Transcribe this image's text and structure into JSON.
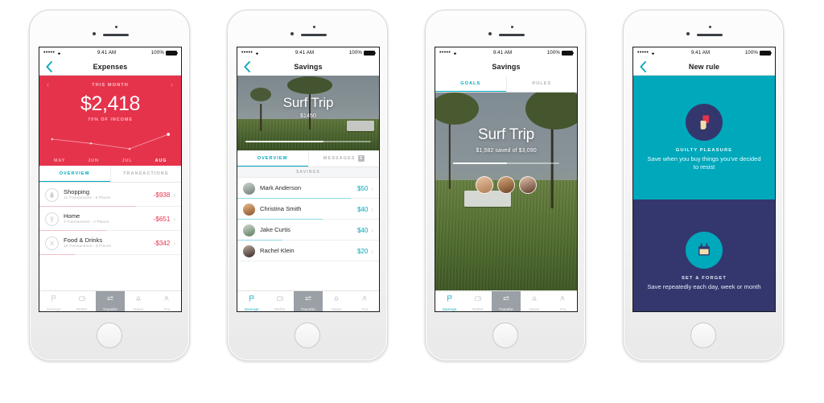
{
  "colors": {
    "red": "#e6334c",
    "teal": "#00a8bc",
    "navy": "#33376e",
    "gray": "#9aa0a6"
  },
  "statusbar": {
    "signal": "•••••",
    "time": "9:41 AM",
    "battery": "100%"
  },
  "tabbar": {
    "items": [
      {
        "label": "Savings",
        "icon": "flag-icon"
      },
      {
        "label": "Wallet",
        "icon": "wallet-icon"
      },
      {
        "label": "Transfer",
        "icon": "transfer-icon"
      },
      {
        "label": "News",
        "icon": "bell-icon"
      },
      {
        "label": "You",
        "icon": "person-icon"
      }
    ]
  },
  "phone1": {
    "nav_title": "Expenses",
    "hero": {
      "period_label": "THIS MONTH",
      "amount": "$2,418",
      "subtitle": "70% OF INCOME"
    },
    "chart_data": {
      "type": "line",
      "title": "Monthly expenses",
      "categories": [
        "MAY",
        "JUN",
        "JUL",
        "AUG"
      ],
      "values": [
        72,
        58,
        40,
        88
      ],
      "highlight_index": 3,
      "xlabel": "",
      "ylabel": "",
      "ylim": [
        0,
        100
      ],
      "grid": false,
      "legend": "none"
    },
    "tabs": [
      {
        "label": "OVERVIEW",
        "active": true
      },
      {
        "label": "TRANSACTIONS",
        "active": false
      }
    ],
    "rows": [
      {
        "title": "Shopping",
        "sub": "11 Transactions - 9 Places",
        "value": "-$938",
        "icon": "shopping-bag-icon",
        "bar": 68
      },
      {
        "title": "Home",
        "sub": "3 Transactions - 2 Places",
        "value": "-$651",
        "icon": "lamp-icon",
        "bar": 47
      },
      {
        "title": "Food & Drinks",
        "sub": "16 Transactions - 8 Places",
        "value": "-$342",
        "icon": "cutlery-icon",
        "bar": 25
      }
    ]
  },
  "phone2": {
    "nav_title": "Savings",
    "hero": {
      "title": "Surf Trip",
      "amount": "$1450",
      "progress": 62
    },
    "tabs": [
      {
        "label": "OVERVIEW",
        "active": true,
        "badge": ""
      },
      {
        "label": "MESSAGES",
        "active": false,
        "badge": "5"
      }
    ],
    "section_label": "SAVINGS",
    "people": [
      {
        "name": "Mark Anderson",
        "value": "$50",
        "bar": 80
      },
      {
        "name": "Christina Smith",
        "value": "$40",
        "bar": 60
      },
      {
        "name": "Jake Curtis",
        "value": "$40",
        "bar": 32
      },
      {
        "name": "Rachel Klein",
        "value": "$20",
        "bar": 0
      }
    ]
  },
  "phone3": {
    "nav_title": "Savings",
    "tabs": [
      {
        "label": "GOALS",
        "active": true
      },
      {
        "label": "RULES",
        "active": false
      }
    ],
    "goal": {
      "title": "Surf Trip",
      "subtitle": "$1,582 saved of $3,090",
      "progress": 51
    }
  },
  "phone4": {
    "nav_title": "New rule",
    "cards": [
      {
        "title": "GUILTY PLEASURE",
        "description": "Save when you buy things you've decided to resist",
        "icon": "hand-stop-icon",
        "bg": "#00a8bc",
        "circle": "#33376e"
      },
      {
        "title": "SET & FORGET",
        "description": "Save repeatedly each day, week or month",
        "icon": "calendar-icon",
        "bg": "#33376e",
        "circle": "#00a8bc"
      }
    ]
  }
}
